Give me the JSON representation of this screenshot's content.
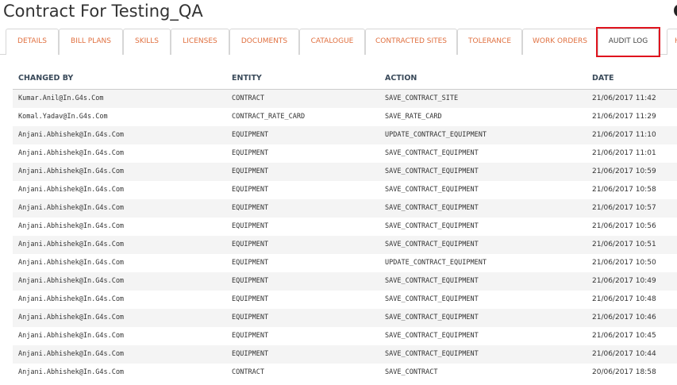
{
  "page": {
    "title": "Contract For Testing_QA",
    "title_cut": "C"
  },
  "tabs": [
    {
      "label": "DETAILS"
    },
    {
      "label": "BILL PLANS"
    },
    {
      "label": "SKILLS"
    },
    {
      "label": "LICENSES"
    },
    {
      "label": "DOCUMENTS"
    },
    {
      "label": "CATALOGUE"
    },
    {
      "label": "CONTRACTED SITES"
    },
    {
      "label": "TOLERANCE"
    },
    {
      "label": "WORK ORDERS"
    },
    {
      "label": "AUDIT LOG"
    },
    {
      "label": "H"
    }
  ],
  "active_tab": "AUDIT LOG",
  "colors": {
    "tab_text": "#e07040",
    "highlight_border": "#e0141e",
    "header_text": "#3a4a5a"
  },
  "audit_table": {
    "columns": [
      "CHANGED BY",
      "ENTITY",
      "ACTION",
      "DATE"
    ],
    "rows": [
      [
        "Kumar.Anil@In.G4s.Com",
        "CONTRACT",
        "SAVE_CONTRACT_SITE",
        "21/06/2017 11:42"
      ],
      [
        "Komal.Yadav@In.G4s.Com",
        "CONTRACT_RATE_CARD",
        "SAVE_RATE_CARD",
        "21/06/2017 11:29"
      ],
      [
        "Anjani.Abhishek@In.G4s.Com",
        "EQUIPMENT",
        "UPDATE_CONTRACT_EQUIPMENT",
        "21/06/2017 11:10"
      ],
      [
        "Anjani.Abhishek@In.G4s.Com",
        "EQUIPMENT",
        "SAVE_CONTRACT_EQUIPMENT",
        "21/06/2017 11:01"
      ],
      [
        "Anjani.Abhishek@In.G4s.Com",
        "EQUIPMENT",
        "SAVE_CONTRACT_EQUIPMENT",
        "21/06/2017 10:59"
      ],
      [
        "Anjani.Abhishek@In.G4s.Com",
        "EQUIPMENT",
        "SAVE_CONTRACT_EQUIPMENT",
        "21/06/2017 10:58"
      ],
      [
        "Anjani.Abhishek@In.G4s.Com",
        "EQUIPMENT",
        "SAVE_CONTRACT_EQUIPMENT",
        "21/06/2017 10:57"
      ],
      [
        "Anjani.Abhishek@In.G4s.Com",
        "EQUIPMENT",
        "SAVE_CONTRACT_EQUIPMENT",
        "21/06/2017 10:56"
      ],
      [
        "Anjani.Abhishek@In.G4s.Com",
        "EQUIPMENT",
        "SAVE_CONTRACT_EQUIPMENT",
        "21/06/2017 10:51"
      ],
      [
        "Anjani.Abhishek@In.G4s.Com",
        "EQUIPMENT",
        "UPDATE_CONTRACT_EQUIPMENT",
        "21/06/2017 10:50"
      ],
      [
        "Anjani.Abhishek@In.G4s.Com",
        "EQUIPMENT",
        "SAVE_CONTRACT_EQUIPMENT",
        "21/06/2017 10:49"
      ],
      [
        "Anjani.Abhishek@In.G4s.Com",
        "EQUIPMENT",
        "SAVE_CONTRACT_EQUIPMENT",
        "21/06/2017 10:48"
      ],
      [
        "Anjani.Abhishek@In.G4s.Com",
        "EQUIPMENT",
        "SAVE_CONTRACT_EQUIPMENT",
        "21/06/2017 10:46"
      ],
      [
        "Anjani.Abhishek@In.G4s.Com",
        "EQUIPMENT",
        "SAVE_CONTRACT_EQUIPMENT",
        "21/06/2017 10:45"
      ],
      [
        "Anjani.Abhishek@In.G4s.Com",
        "EQUIPMENT",
        "SAVE_CONTRACT_EQUIPMENT",
        "21/06/2017 10:44"
      ],
      [
        "Anjani.Abhishek@In.G4s.Com",
        "CONTRACT",
        "SAVE_CONTRACT",
        "20/06/2017 18:58"
      ]
    ]
  }
}
